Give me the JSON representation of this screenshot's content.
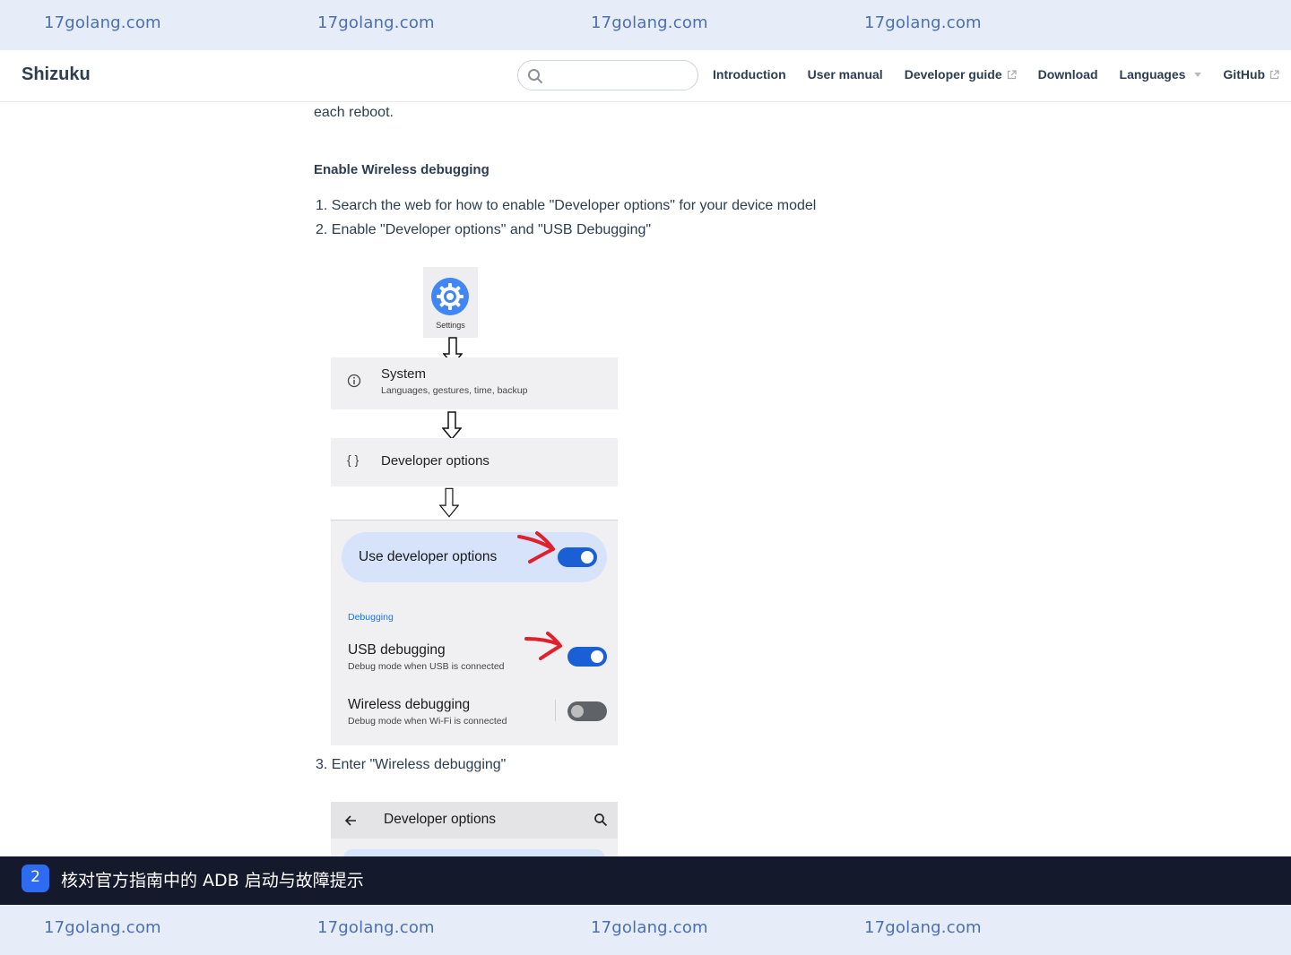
{
  "watermark": {
    "text": "17golang.com"
  },
  "navbar": {
    "site_name": "Shizuku",
    "search": {
      "placeholder": ""
    },
    "links": [
      "Introduction",
      "User manual",
      "Developer guide",
      "Download",
      "Languages",
      "GitHub"
    ]
  },
  "content": {
    "paragraph_tail": "each reboot.",
    "heading": "Enable Wireless debugging",
    "steps": [
      "1. Search the web for how to enable \"Developer options\" for your device model",
      "2. Enable \"Developer options\" and \"USB Debugging\"",
      "3. Enter \"Wireless debugging\""
    ],
    "figure": {
      "settings_label": "Settings",
      "system": {
        "title": "System",
        "subtitle": "Languages, gestures, time, backup",
        "icon": "info-icon"
      },
      "developer_options": {
        "title": "Developer options",
        "icon": "{ }"
      },
      "use_developer_options": {
        "label": "Use developer options",
        "enabled": true
      },
      "section": "Debugging",
      "usb_debugging": {
        "title": "USB debugging",
        "subtitle": "Debug mode when USB is connected",
        "enabled": true
      },
      "wireless_debugging": {
        "title": "Wireless debugging",
        "subtitle": "Debug mode when Wi-Fi is connected",
        "enabled": false
      },
      "annotation_color": "#e0202b"
    },
    "appbar": {
      "title": "Developer options",
      "back_icon": "arrow-left-icon",
      "search_icon": "search-icon"
    }
  },
  "caption": {
    "step_number": "2",
    "text": "核对官方指南中的 ADB 启动与故障提示"
  },
  "colors": {
    "watermark_bar": "#e6edf9",
    "watermark_text": "#4a6fb3",
    "caption_bar": "#141a2b",
    "badge": "#2d6cf0",
    "toggle_on": "#1a5fd6",
    "pill": "#d7e3fa"
  }
}
